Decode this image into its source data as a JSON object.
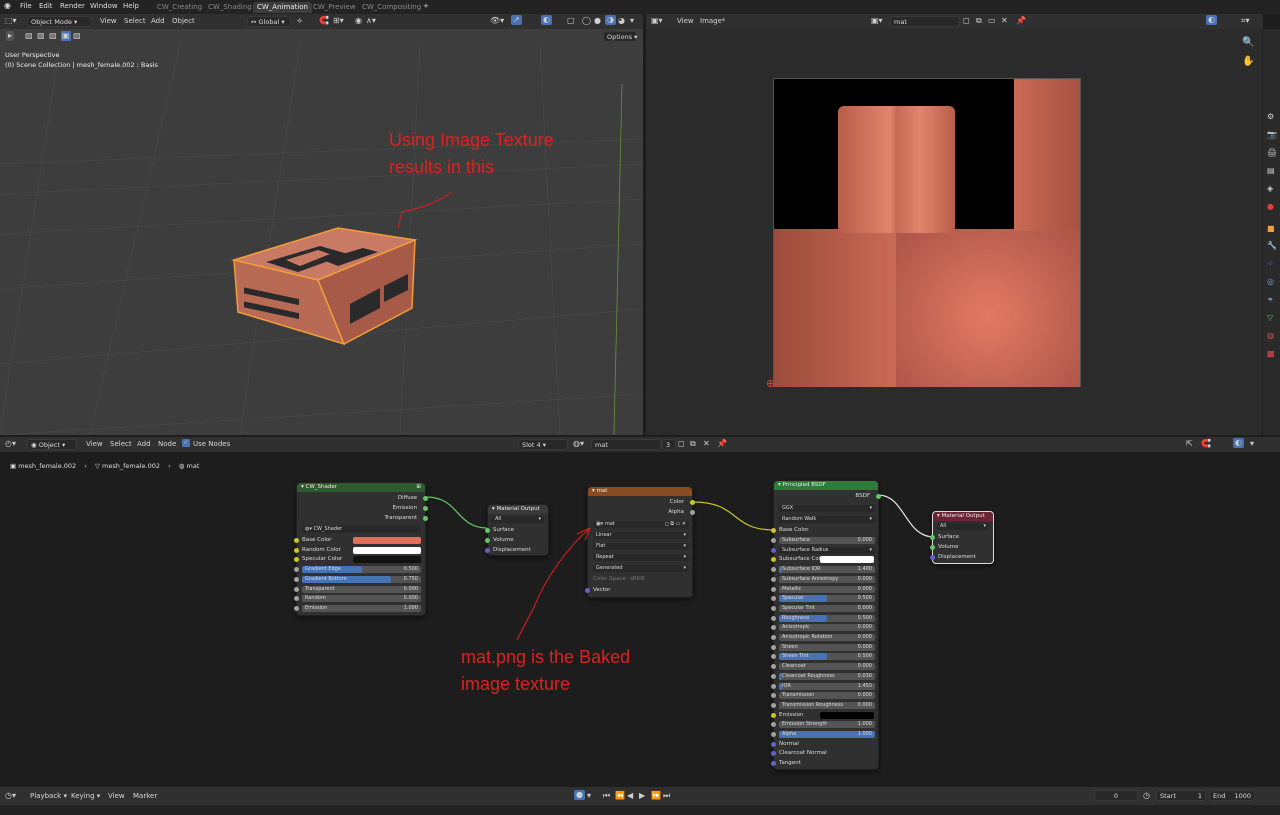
{
  "menu": [
    "File",
    "Edit",
    "Render",
    "Window",
    "Help"
  ],
  "workspaces": [
    "CW_Creating",
    "CW_Shading",
    "CW_Animation",
    "CW_Preview",
    "CW_Compositing"
  ],
  "add_tab": "+",
  "viewport": {
    "mode": "Object Mode",
    "menu": [
      "View",
      "Select",
      "Add",
      "Object"
    ],
    "transform": "Global",
    "options": "Options",
    "overlay_title": "User Perspective",
    "overlay_sub": "(0) Scene Collection | mesh_female.002 : Basis"
  },
  "image_editor": {
    "menu": [
      "View",
      "Image*"
    ],
    "image_name": "mat"
  },
  "node_editor": {
    "type": "Object",
    "menu": [
      "View",
      "Select",
      "Add",
      "Node"
    ],
    "use_nodes": "Use Nodes",
    "slot": "Slot 4",
    "material": "mat",
    "users": "3",
    "breadcrumb": [
      "mesh_female.002",
      "mesh_female.002",
      "mat"
    ]
  },
  "nodes": {
    "cw_shader": {
      "title": "CW_Shader",
      "outputs": [
        "Diffuse",
        "Emission",
        "Transparent"
      ],
      "group": "CW_Shader",
      "rows": [
        {
          "label": "Base Color",
          "type": "color",
          "color": "#e0705a"
        },
        {
          "label": "Random Color",
          "type": "color",
          "color": "#ffffff"
        },
        {
          "label": "Specular Color",
          "type": "color",
          "color": "#111111"
        },
        {
          "label": "Gradient Edge",
          "value": "0.500",
          "fill": 0.5
        },
        {
          "label": "Gradient Bottom",
          "value": "0.750",
          "fill": 0.75
        },
        {
          "label": "Transparent",
          "value": "0.000",
          "fill": 0
        },
        {
          "label": "Random",
          "value": "0.000",
          "fill": 0
        },
        {
          "label": "Emission",
          "value": "1.000",
          "fill": 0
        }
      ]
    },
    "mat_out_1": {
      "title": "Material Output",
      "target": "All",
      "inputs": [
        "Surface",
        "Volume",
        "Displacement"
      ]
    },
    "image_tex": {
      "title": "mat",
      "outputs": [
        "Color",
        "Alpha"
      ],
      "image": "mat",
      "interp": "Linear",
      "proj": "Flat",
      "ext": "Repeat",
      "source": "Generated",
      "colorspace_label": "Color Space",
      "colorspace": "sRGB",
      "vector": "Vector"
    },
    "bsdf": {
      "title": "Principled BSDF",
      "output": "BSDF",
      "dist": "GGX",
      "sss": "Random Walk",
      "base_color": "Base Color",
      "rows": [
        {
          "label": "Subsurface",
          "value": "0.000",
          "fill": 0
        },
        {
          "label": "Subsurface Radius",
          "type": "dd"
        },
        {
          "label": "Subsurface Colo",
          "type": "color",
          "color": "#ffffff"
        },
        {
          "label": "Subsurface IOR",
          "value": "1.400",
          "fill": 0.03
        },
        {
          "label": "Subsurface Anisotropy",
          "value": "0.000",
          "fill": 0
        },
        {
          "label": "Metallic",
          "value": "0.000",
          "fill": 0
        },
        {
          "label": "Specular",
          "value": "0.500",
          "fill": 0.5
        },
        {
          "label": "Specular Tint",
          "value": "0.000",
          "fill": 0
        },
        {
          "label": "Roughness",
          "value": "0.500",
          "fill": 0.5
        },
        {
          "label": "Anisotropic",
          "value": "0.000",
          "fill": 0
        },
        {
          "label": "Anisotropic Rotation",
          "value": "0.000",
          "fill": 0
        },
        {
          "label": "Sheen",
          "value": "0.000",
          "fill": 0
        },
        {
          "label": "Sheen Tint",
          "value": "0.500",
          "fill": 0.5
        },
        {
          "label": "Clearcoat",
          "value": "0.000",
          "fill": 0
        },
        {
          "label": "Clearcoat Roughness",
          "value": "0.030",
          "fill": 0.03
        },
        {
          "label": "IOR",
          "value": "1.450",
          "fill": 0.03
        },
        {
          "label": "Transmission",
          "value": "0.000",
          "fill": 0
        },
        {
          "label": "Transmission Roughness",
          "value": "0.000",
          "fill": 0
        },
        {
          "label": "Emission",
          "type": "color",
          "color": "#000000"
        },
        {
          "label": "Emission Strength",
          "value": "1.000",
          "fill": 0
        },
        {
          "label": "Alpha",
          "value": "1.000",
          "fill": 1
        }
      ],
      "inputs_tail": [
        "Normal",
        "Clearcoat Normal",
        "Tangent"
      ]
    },
    "mat_out_2": {
      "title": "Material Output",
      "target": "All",
      "inputs": [
        "Surface",
        "Volume",
        "Displacement"
      ]
    }
  },
  "annotations": {
    "top": [
      "Using Image Texture",
      "results in this"
    ],
    "bottom": [
      "mat.png is the Baked",
      "image texture"
    ],
    "color": "#e02020"
  },
  "timeline": {
    "menu": [
      "Playback",
      "Keying",
      "View",
      "Marker"
    ],
    "current_frame": "0",
    "start_label": "Start",
    "start": "1",
    "end_label": "End",
    "end": "1000"
  }
}
